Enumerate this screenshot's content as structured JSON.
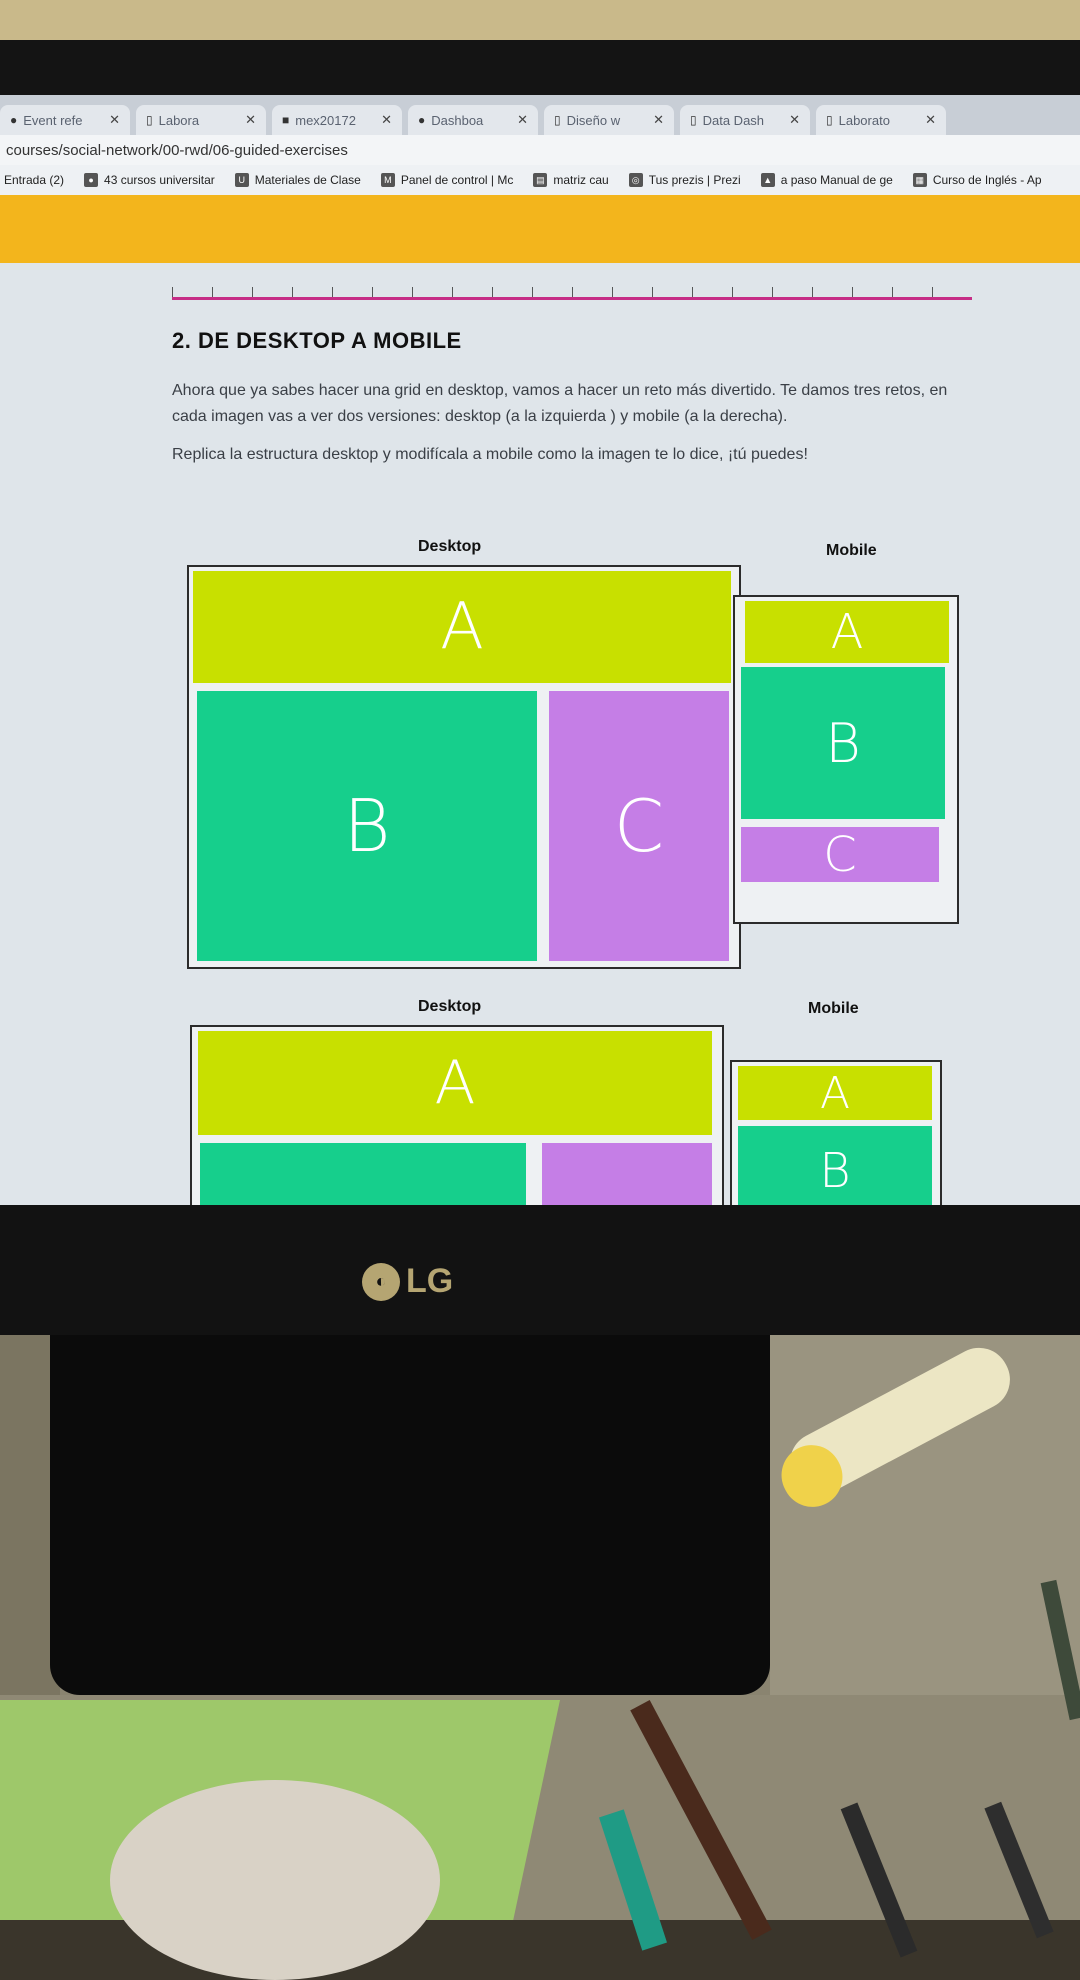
{
  "browser": {
    "tabs": [
      {
        "label": "Event refe",
        "icon": "github-icon"
      },
      {
        "label": "Labora",
        "icon": "document-icon"
      },
      {
        "label": "mex20172",
        "icon": "app-icon"
      },
      {
        "label": "Dashboa",
        "icon": "github-icon"
      },
      {
        "label": "Diseño w",
        "icon": "document-icon"
      },
      {
        "label": "Data Dash",
        "icon": "document-icon"
      },
      {
        "label": "Laborato",
        "icon": "document-icon"
      }
    ],
    "url": "courses/social-network/00-rwd/06-guided-exercises",
    "bookmarks": [
      {
        "label": "Entrada (2)",
        "icon": "mail-icon"
      },
      {
        "label": "43 cursos universitar",
        "icon": "globe-icon"
      },
      {
        "label": "Materiales de Clase",
        "icon": "uc-icon"
      },
      {
        "label": "Panel de control | Mc",
        "icon": "mx-icon"
      },
      {
        "label": "matriz cau",
        "icon": "doc-icon"
      },
      {
        "label": "Tus prezis | Prezi",
        "icon": "prezi-icon"
      },
      {
        "label": "a paso Manual de ge",
        "icon": "tree-icon"
      },
      {
        "label": "Curso de Inglés - Ap",
        "icon": "book-icon"
      }
    ]
  },
  "content": {
    "section_title": "2. DE DESKTOP A MOBILE",
    "intro": "Ahora que ya sabes hacer una grid en desktop, vamos a hacer un reto más divertido. Te damos tres retos, en cada imagen vas a ver dos versiones: desktop (a la izquierda ) y mobile (a la derecha).",
    "instruction": "Replica la estructura desktop y modifícala a mobile como la imagen te lo dice, ¡tú puedes!"
  },
  "exercises": [
    {
      "desktop_caption": "Desktop",
      "mobile_caption": "Mobile",
      "blocks": {
        "a": "A",
        "b": "B",
        "c": "C"
      }
    },
    {
      "desktop_caption": "Desktop",
      "mobile_caption": "Mobile",
      "blocks": {
        "a": "A",
        "b": "B"
      }
    }
  ],
  "monitor": {
    "brand": "LG"
  },
  "colors": {
    "header": "#f3b51c",
    "block_a": "#c8e000",
    "block_b": "#16cf8c",
    "block_c": "#c57ee6"
  }
}
